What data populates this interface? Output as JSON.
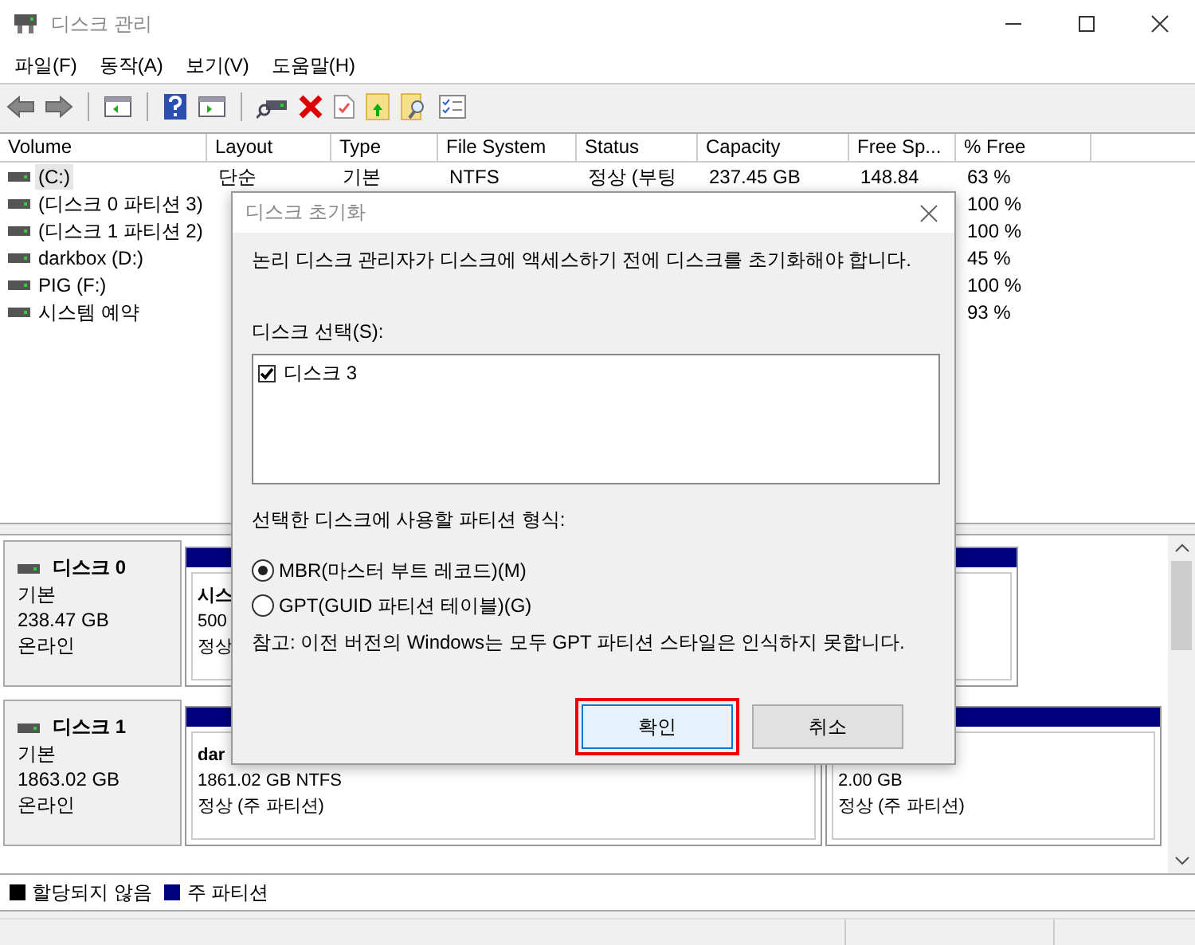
{
  "window": {
    "title": "디스크 관리"
  },
  "menu": [
    "파일(F)",
    "동작(A)",
    "보기(V)",
    "도움말(H)"
  ],
  "volume_table": {
    "columns": [
      "Volume",
      "Layout",
      "Type",
      "File System",
      "Status",
      "Capacity",
      "Free Sp...",
      "% Free"
    ],
    "rows": [
      {
        "selected": true,
        "volume": "(C:)",
        "layout": "단순",
        "type": "기본",
        "file_system": "NTFS",
        "status": "정상 (부팅",
        "capacity": "237.45 GB",
        "free_space": "148.84",
        "percent_free": "63 %"
      },
      {
        "selected": false,
        "volume": "(디스크 0 파티션 3)",
        "percent_free": "100 %"
      },
      {
        "selected": false,
        "volume": "(디스크 1 파티션 2)",
        "percent_free": "100 %"
      },
      {
        "selected": false,
        "volume": "darkbox (D:)",
        "percent_free": "45 %"
      },
      {
        "selected": false,
        "volume": "PIG (F:)",
        "percent_free": "100 %"
      },
      {
        "selected": false,
        "volume": "시스템 예약",
        "percent_free": "93 %"
      }
    ]
  },
  "disks": [
    {
      "name": "디스크 0",
      "type": "기본",
      "size": "238.47 GB",
      "status": "온라인",
      "partitions": [
        {
          "title": "시스",
          "lines": [
            "500",
            "정상"
          ]
        }
      ]
    },
    {
      "name": "디스크 1",
      "type": "기본",
      "size": "1863.02 GB",
      "status": "온라인",
      "partitions": [
        {
          "title": "dar",
          "lines": [
            "1861.02 GB NTFS",
            "정상 (주 파티션)"
          ]
        },
        {
          "lines": [
            "2.00 GB",
            "정상 (주 파티션)"
          ]
        }
      ]
    }
  ],
  "legend": [
    {
      "label": "할당되지 않음",
      "color": "#000000"
    },
    {
      "label": "주 파티션",
      "color": "#000080"
    }
  ],
  "dialog": {
    "title": "디스크 초기화",
    "message": "논리 디스크 관리자가 디스크에 액세스하기 전에 디스크를 초기화해야 합니다.",
    "disk_list_label": "디스크 선택(S):",
    "disks": [
      {
        "label": "디스크 3",
        "checked": true
      }
    ],
    "style_label": "선택한 디스크에 사용할 파티션 형식:",
    "styles": [
      {
        "label": "MBR(마스터 부트 레코드)(M)",
        "selected": true
      },
      {
        "label": "GPT(GUID 파티션 테이블)(G)",
        "selected": false
      }
    ],
    "note": "참고: 이전 버전의 Windows는 모두 GPT 파티션 스타일은 인식하지 못합니다.",
    "buttons": [
      {
        "label": "확인",
        "focused": true
      },
      {
        "label": "취소",
        "focused": false
      }
    ]
  }
}
